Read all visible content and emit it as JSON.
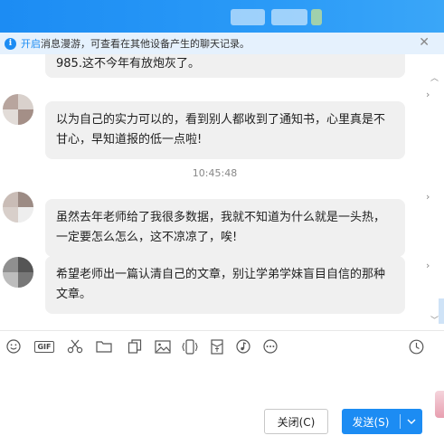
{
  "notice": {
    "link_text": "开启",
    "text": "消息漫游，可查看在其他设备产生的聊天记录。",
    "close_glyph": "✕"
  },
  "chat": {
    "messages": [
      {
        "text": "985.这不今年有放炮灰了。"
      },
      {
        "text": "以为自己的实力可以的，看到别人都收到了通知书，心里真是不甘心，早知道报的低一点啦!"
      },
      {
        "text": "虽然去年老师给了我很多数据，我就不知道为什么就是一头热，一定要怎么怎么，这不凉凉了，唉!"
      },
      {
        "text": "希望老师出一篇认清自己的文章，别让学弟学妹盲目自信的那种文章。"
      }
    ],
    "timestamp": "10:45:48"
  },
  "call_buttons": [
    "phone-icon",
    "video-icon",
    "more-icon"
  ],
  "toolbar": {
    "icons": [
      "emoji-icon",
      "gif-icon",
      "scissors-icon",
      "folder-icon",
      "file-copy-icon",
      "image-icon",
      "shake-icon",
      "red-packet-icon",
      "music-icon",
      "more-tools-icon",
      "history-icon"
    ],
    "gif_label": "GIF"
  },
  "buttons": {
    "close_label": "关闭(C)",
    "send_label": "发送(S)"
  },
  "colors": {
    "accent": "#1c8cf3",
    "bubble": "#f0f0f0",
    "notice_bg": "#e5f1fd"
  }
}
